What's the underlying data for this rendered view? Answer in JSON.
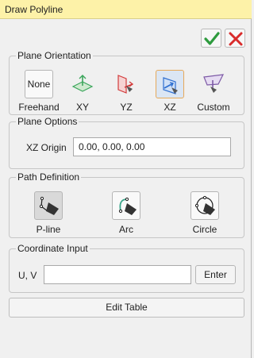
{
  "window": {
    "title": "Draw Polyline"
  },
  "actions": {
    "ok_icon": "checkmark-icon",
    "cancel_icon": "close-icon",
    "ok_color": "#2e9b3e",
    "cancel_color": "#d92b2b"
  },
  "plane_orientation": {
    "legend": "Plane Orientation",
    "tools": [
      {
        "id": "freehand",
        "text": "None",
        "label": "Freehand",
        "icon": "none-icon"
      },
      {
        "id": "xy",
        "label": "XY",
        "icon": "xy-plane-icon"
      },
      {
        "id": "yz",
        "label": "YZ",
        "icon": "yz-plane-icon"
      },
      {
        "id": "xz",
        "label": "XZ",
        "icon": "xz-plane-icon",
        "selected": true
      },
      {
        "id": "custom",
        "label": "Custom",
        "icon": "custom-plane-icon"
      }
    ]
  },
  "plane_options": {
    "legend": "Plane Options",
    "origin_label": "XZ Origin",
    "origin_value": "0.00, 0.00, 0.00"
  },
  "path_definition": {
    "legend": "Path Definition",
    "tools": [
      {
        "id": "pline",
        "label": "P-line",
        "icon": "pline-icon",
        "selected": true
      },
      {
        "id": "arc",
        "label": "Arc",
        "icon": "arc-icon"
      },
      {
        "id": "circle",
        "label": "Circle",
        "icon": "circle-icon"
      }
    ]
  },
  "coordinate_input": {
    "legend": "Coordinate Input",
    "label": "U, V",
    "value": "",
    "enter_label": "Enter"
  },
  "edit_table_label": "Edit Table"
}
